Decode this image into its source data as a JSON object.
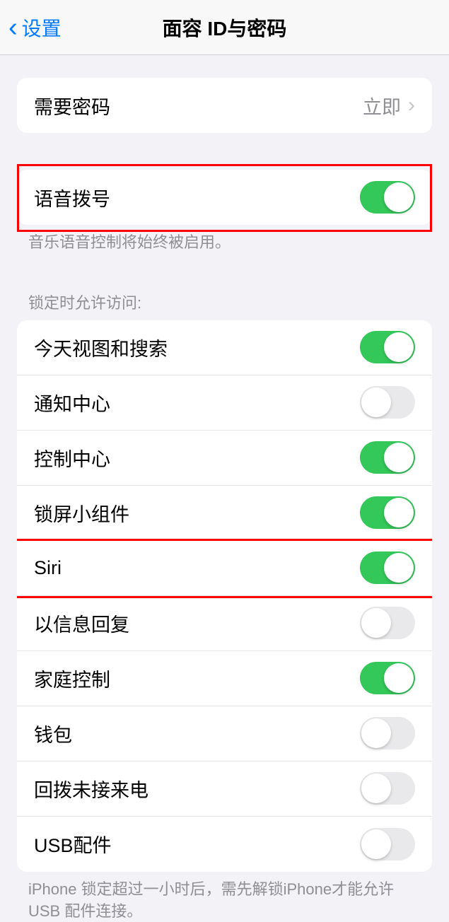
{
  "nav": {
    "back_label": "设置",
    "title": "面容 ID与密码"
  },
  "section1": {
    "require_passcode": {
      "label": "需要密码",
      "value": "立即"
    }
  },
  "section2": {
    "voice_dial": {
      "label": "语音拨号",
      "on": true
    },
    "footer": "音乐语音控制将始终被启用。"
  },
  "section3": {
    "header": "锁定时允许访问:",
    "items": [
      {
        "label": "今天视图和搜索",
        "on": true
      },
      {
        "label": "通知中心",
        "on": false
      },
      {
        "label": "控制中心",
        "on": true
      },
      {
        "label": "锁屏小组件",
        "on": true
      },
      {
        "label": "Siri",
        "on": true
      },
      {
        "label": "以信息回复",
        "on": false
      },
      {
        "label": "家庭控制",
        "on": true
      },
      {
        "label": "钱包",
        "on": false
      },
      {
        "label": "回拨未接来电",
        "on": false
      },
      {
        "label": "USB配件",
        "on": false
      }
    ],
    "footer": "iPhone 锁定超过一小时后，需先解锁iPhone才能允许USB 配件连接。"
  }
}
